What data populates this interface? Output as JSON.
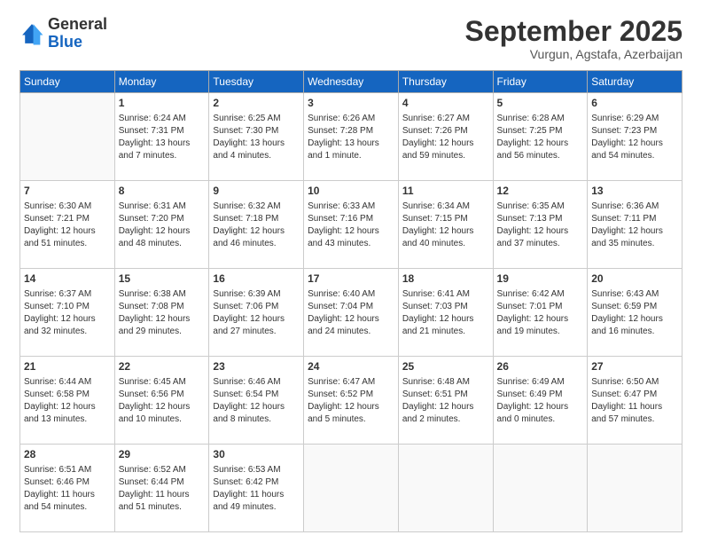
{
  "logo": {
    "line1": "General",
    "line2": "Blue"
  },
  "header": {
    "month": "September 2025",
    "location": "Vurgun, Agstafa, Azerbaijan"
  },
  "days_of_week": [
    "Sunday",
    "Monday",
    "Tuesday",
    "Wednesday",
    "Thursday",
    "Friday",
    "Saturday"
  ],
  "weeks": [
    [
      {
        "day": "",
        "sunrise": "",
        "sunset": "",
        "daylight": "",
        "empty": true
      },
      {
        "day": "1",
        "sunrise": "Sunrise: 6:24 AM",
        "sunset": "Sunset: 7:31 PM",
        "daylight": "Daylight: 13 hours and 7 minutes."
      },
      {
        "day": "2",
        "sunrise": "Sunrise: 6:25 AM",
        "sunset": "Sunset: 7:30 PM",
        "daylight": "Daylight: 13 hours and 4 minutes."
      },
      {
        "day": "3",
        "sunrise": "Sunrise: 6:26 AM",
        "sunset": "Sunset: 7:28 PM",
        "daylight": "Daylight: 13 hours and 1 minute."
      },
      {
        "day": "4",
        "sunrise": "Sunrise: 6:27 AM",
        "sunset": "Sunset: 7:26 PM",
        "daylight": "Daylight: 12 hours and 59 minutes."
      },
      {
        "day": "5",
        "sunrise": "Sunrise: 6:28 AM",
        "sunset": "Sunset: 7:25 PM",
        "daylight": "Daylight: 12 hours and 56 minutes."
      },
      {
        "day": "6",
        "sunrise": "Sunrise: 6:29 AM",
        "sunset": "Sunset: 7:23 PM",
        "daylight": "Daylight: 12 hours and 54 minutes."
      }
    ],
    [
      {
        "day": "7",
        "sunrise": "Sunrise: 6:30 AM",
        "sunset": "Sunset: 7:21 PM",
        "daylight": "Daylight: 12 hours and 51 minutes."
      },
      {
        "day": "8",
        "sunrise": "Sunrise: 6:31 AM",
        "sunset": "Sunset: 7:20 PM",
        "daylight": "Daylight: 12 hours and 48 minutes."
      },
      {
        "day": "9",
        "sunrise": "Sunrise: 6:32 AM",
        "sunset": "Sunset: 7:18 PM",
        "daylight": "Daylight: 12 hours and 46 minutes."
      },
      {
        "day": "10",
        "sunrise": "Sunrise: 6:33 AM",
        "sunset": "Sunset: 7:16 PM",
        "daylight": "Daylight: 12 hours and 43 minutes."
      },
      {
        "day": "11",
        "sunrise": "Sunrise: 6:34 AM",
        "sunset": "Sunset: 7:15 PM",
        "daylight": "Daylight: 12 hours and 40 minutes."
      },
      {
        "day": "12",
        "sunrise": "Sunrise: 6:35 AM",
        "sunset": "Sunset: 7:13 PM",
        "daylight": "Daylight: 12 hours and 37 minutes."
      },
      {
        "day": "13",
        "sunrise": "Sunrise: 6:36 AM",
        "sunset": "Sunset: 7:11 PM",
        "daylight": "Daylight: 12 hours and 35 minutes."
      }
    ],
    [
      {
        "day": "14",
        "sunrise": "Sunrise: 6:37 AM",
        "sunset": "Sunset: 7:10 PM",
        "daylight": "Daylight: 12 hours and 32 minutes."
      },
      {
        "day": "15",
        "sunrise": "Sunrise: 6:38 AM",
        "sunset": "Sunset: 7:08 PM",
        "daylight": "Daylight: 12 hours and 29 minutes."
      },
      {
        "day": "16",
        "sunrise": "Sunrise: 6:39 AM",
        "sunset": "Sunset: 7:06 PM",
        "daylight": "Daylight: 12 hours and 27 minutes."
      },
      {
        "day": "17",
        "sunrise": "Sunrise: 6:40 AM",
        "sunset": "Sunset: 7:04 PM",
        "daylight": "Daylight: 12 hours and 24 minutes."
      },
      {
        "day": "18",
        "sunrise": "Sunrise: 6:41 AM",
        "sunset": "Sunset: 7:03 PM",
        "daylight": "Daylight: 12 hours and 21 minutes."
      },
      {
        "day": "19",
        "sunrise": "Sunrise: 6:42 AM",
        "sunset": "Sunset: 7:01 PM",
        "daylight": "Daylight: 12 hours and 19 minutes."
      },
      {
        "day": "20",
        "sunrise": "Sunrise: 6:43 AM",
        "sunset": "Sunset: 6:59 PM",
        "daylight": "Daylight: 12 hours and 16 minutes."
      }
    ],
    [
      {
        "day": "21",
        "sunrise": "Sunrise: 6:44 AM",
        "sunset": "Sunset: 6:58 PM",
        "daylight": "Daylight: 12 hours and 13 minutes."
      },
      {
        "day": "22",
        "sunrise": "Sunrise: 6:45 AM",
        "sunset": "Sunset: 6:56 PM",
        "daylight": "Daylight: 12 hours and 10 minutes."
      },
      {
        "day": "23",
        "sunrise": "Sunrise: 6:46 AM",
        "sunset": "Sunset: 6:54 PM",
        "daylight": "Daylight: 12 hours and 8 minutes."
      },
      {
        "day": "24",
        "sunrise": "Sunrise: 6:47 AM",
        "sunset": "Sunset: 6:52 PM",
        "daylight": "Daylight: 12 hours and 5 minutes."
      },
      {
        "day": "25",
        "sunrise": "Sunrise: 6:48 AM",
        "sunset": "Sunset: 6:51 PM",
        "daylight": "Daylight: 12 hours and 2 minutes."
      },
      {
        "day": "26",
        "sunrise": "Sunrise: 6:49 AM",
        "sunset": "Sunset: 6:49 PM",
        "daylight": "Daylight: 12 hours and 0 minutes."
      },
      {
        "day": "27",
        "sunrise": "Sunrise: 6:50 AM",
        "sunset": "Sunset: 6:47 PM",
        "daylight": "Daylight: 11 hours and 57 minutes."
      }
    ],
    [
      {
        "day": "28",
        "sunrise": "Sunrise: 6:51 AM",
        "sunset": "Sunset: 6:46 PM",
        "daylight": "Daylight: 11 hours and 54 minutes."
      },
      {
        "day": "29",
        "sunrise": "Sunrise: 6:52 AM",
        "sunset": "Sunset: 6:44 PM",
        "daylight": "Daylight: 11 hours and 51 minutes."
      },
      {
        "day": "30",
        "sunrise": "Sunrise: 6:53 AM",
        "sunset": "Sunset: 6:42 PM",
        "daylight": "Daylight: 11 hours and 49 minutes."
      },
      {
        "day": "",
        "sunrise": "",
        "sunset": "",
        "daylight": "",
        "empty": true
      },
      {
        "day": "",
        "sunrise": "",
        "sunset": "",
        "daylight": "",
        "empty": true
      },
      {
        "day": "",
        "sunrise": "",
        "sunset": "",
        "daylight": "",
        "empty": true
      },
      {
        "day": "",
        "sunrise": "",
        "sunset": "",
        "daylight": "",
        "empty": true
      }
    ]
  ]
}
